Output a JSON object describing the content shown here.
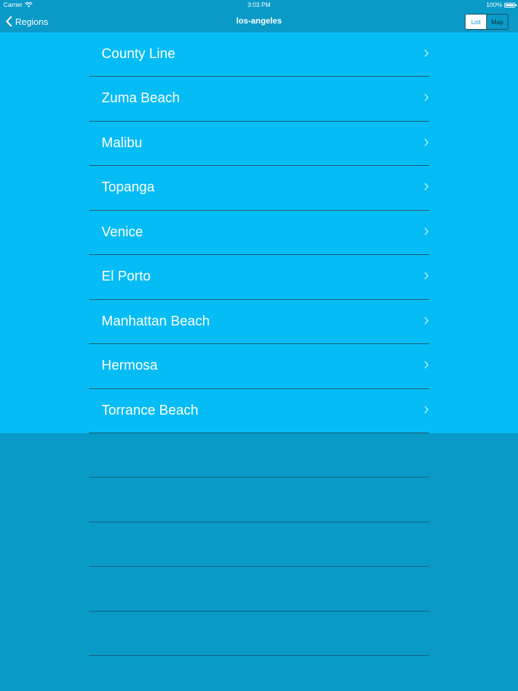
{
  "status_bar": {
    "carrier": "Carrier",
    "time": "3:03 PM",
    "battery": "100%"
  },
  "nav": {
    "back_label": "Regions",
    "title": "los-angeles",
    "segments": [
      "List",
      "Map"
    ],
    "selected_segment": "List"
  },
  "spots": [
    {
      "name": "County Line"
    },
    {
      "name": "Zuma Beach"
    },
    {
      "name": "Malibu"
    },
    {
      "name": "Topanga"
    },
    {
      "name": "Venice"
    },
    {
      "name": "El Porto"
    },
    {
      "name": "Manhattan Beach"
    },
    {
      "name": "Hermosa"
    },
    {
      "name": "Torrance Beach"
    }
  ],
  "colors": {
    "background": "#0a9ac8",
    "panel": "#06bcf5",
    "separator": "#1d5566",
    "text": "#ffffff"
  },
  "icons": {
    "back": "chevron-left-icon",
    "row": "chevron-right-icon",
    "wifi": "wifi-icon",
    "battery": "battery-icon"
  }
}
